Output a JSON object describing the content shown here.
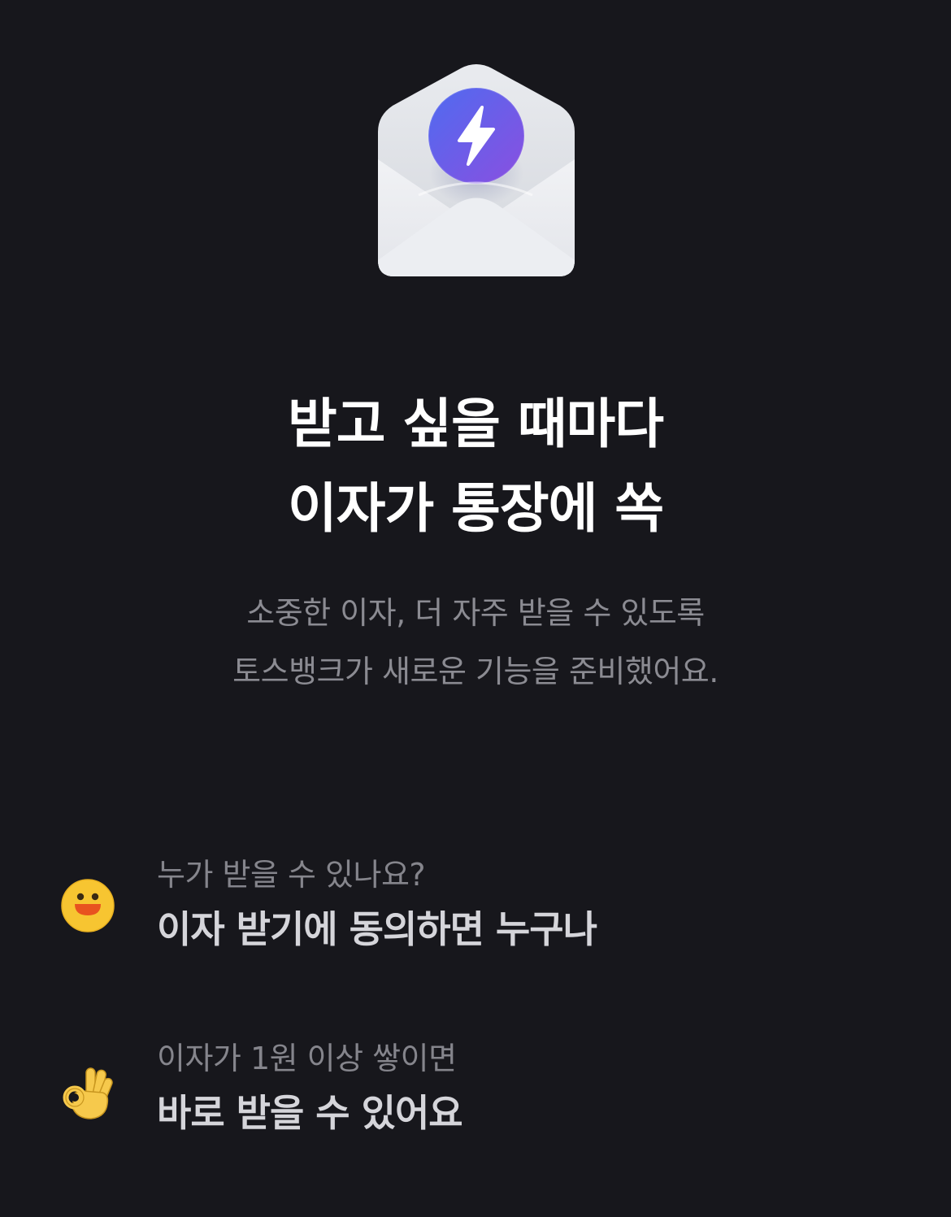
{
  "hero": {
    "icon": "envelope-with-lightning-coin-icon",
    "coin_gradient": [
      "#4f6bf0",
      "#8a4fe0"
    ]
  },
  "headline": {
    "line1": "받고 싶을 때마다",
    "line2": "이자가 통장에 쏙"
  },
  "description": {
    "line1": "소중한 이자, 더 자주 받을 수 있도록",
    "line2": "토스뱅크가 새로운 기능을 준비했어요."
  },
  "info_items": [
    {
      "icon": "smiling-face-icon",
      "caption": "누가 받을 수 있나요?",
      "value": "이자 받기에 동의하면 누구나"
    },
    {
      "icon": "ok-hand-icon",
      "caption": "이자가 1원 이상 쌓이면",
      "value": "바로 받을 수 있어요"
    }
  ],
  "colors": {
    "background": "#17171c",
    "headline": "#ffffff",
    "secondary_text": "#8b8b92",
    "emphasis_text": "#d5d5da"
  }
}
